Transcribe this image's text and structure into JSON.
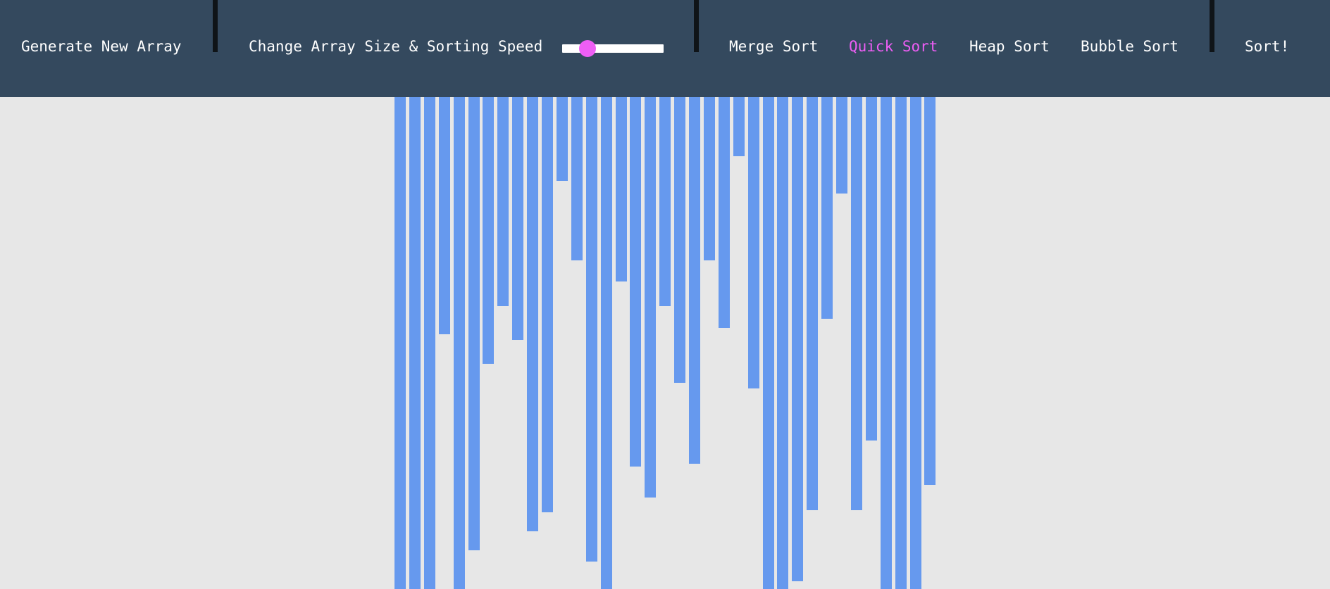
{
  "toolbar": {
    "generate_label": "Generate New Array",
    "size_speed_label": "Change Array Size & Sorting Speed",
    "slider_value": 0.25,
    "algorithms": [
      "Merge Sort",
      "Quick Sort",
      "Heap Sort",
      "Bubble Sort"
    ],
    "selected_algorithm": "Quick Sort",
    "sort_label": "Sort!"
  },
  "colors": {
    "toolbar_bg": "#34495e",
    "page_bg": "#e7e7e7",
    "bar": "#6699ee",
    "accent": "#ee5ef5",
    "divider": "#0f1418"
  },
  "array": {
    "count": 37,
    "max_value": 700,
    "values": [
      700,
      700,
      700,
      337,
      700,
      645,
      380,
      297,
      345,
      618,
      591,
      119,
      232,
      661,
      700,
      262,
      526,
      570,
      297,
      407,
      522,
      232,
      328,
      84,
      415,
      700,
      700,
      689,
      588,
      315,
      137,
      588,
      489,
      700,
      700,
      700,
      552
    ]
  }
}
